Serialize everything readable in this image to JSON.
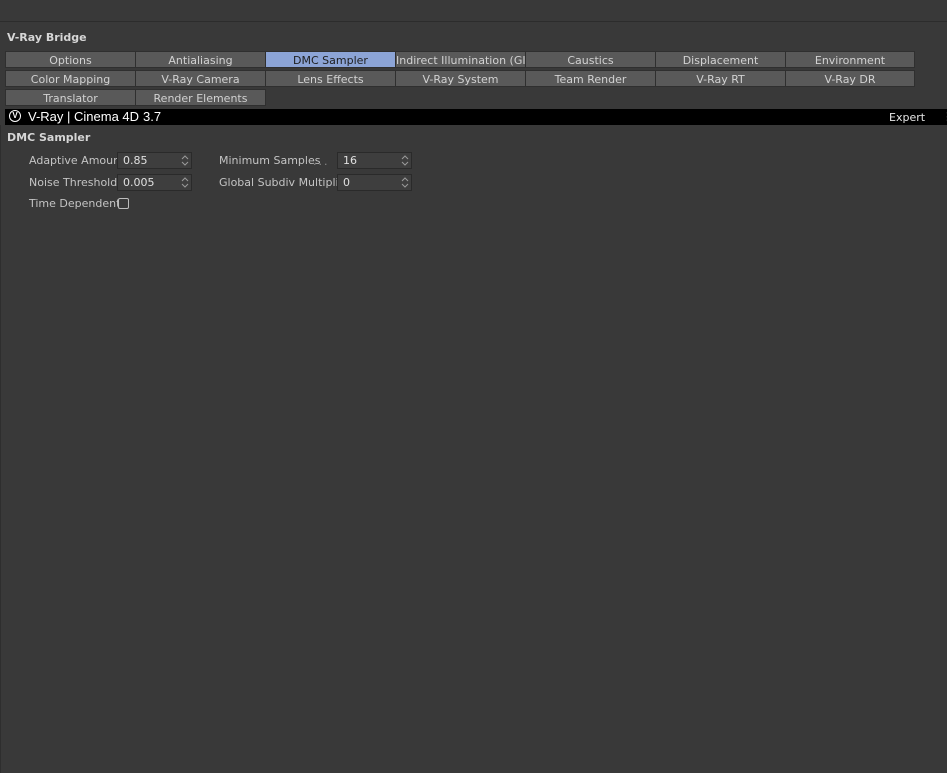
{
  "panel": {
    "title": "V-Ray Bridge"
  },
  "tabs": {
    "row1": [
      "Options",
      "Antialiasing",
      "DMC Sampler",
      "Indirect Illumination (GI)",
      "Caustics",
      "Displacement",
      "Environment"
    ],
    "row2": [
      "Color Mapping",
      "V-Ray Camera",
      "Lens Effects",
      "V-Ray System",
      "Team Render",
      "V-Ray RT",
      "V-Ray DR"
    ],
    "row3": [
      "Translator",
      "Render Elements"
    ],
    "active": "DMC Sampler"
  },
  "header": {
    "logo_icon": "vray-logo-icon",
    "logo_glyph": "V",
    "title": "V-Ray | Cinema 4D",
    "version": "3.7",
    "mode": "Expert",
    "menu_icon": "more-vertical-icon",
    "menu_glyph": "⋮"
  },
  "section": {
    "title": "DMC Sampler"
  },
  "fields": {
    "adaptive_amount": {
      "label": "Adaptive Amount",
      "value": "0.85"
    },
    "noise_threshold": {
      "label": "Noise Threshold",
      "value": "0.005"
    },
    "time_dependent": {
      "label": "Time Dependent",
      "checked": false
    },
    "minimum_samples": {
      "label": "Minimum Samples",
      "dots": "...",
      "value": "16"
    },
    "global_subdiv_multiplier": {
      "label": "Global Subdiv Multiplier",
      "value": "0"
    }
  },
  "colors": {
    "background": "#393939",
    "tab": "#595959",
    "tab_active": "#8ca4d6",
    "header_bar": "#000000"
  }
}
